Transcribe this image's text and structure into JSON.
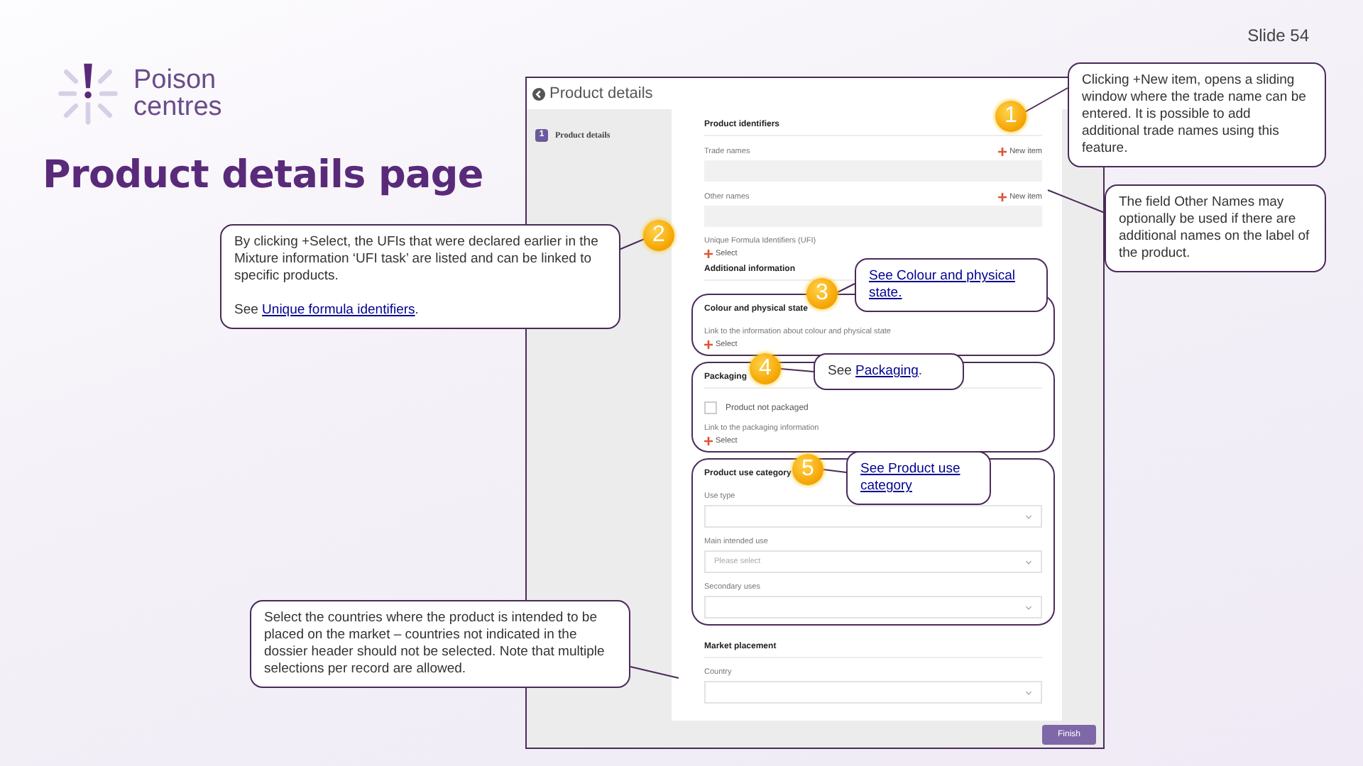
{
  "slide_number": "Slide 54",
  "logo": {
    "line_1": "Poison",
    "line_2": "centres"
  },
  "title": "Product details page",
  "app": {
    "title": "Product details",
    "steps": [
      {
        "number": "1",
        "label": "Product details",
        "selected": true
      }
    ],
    "sections": [
      {
        "outlined": false,
        "items": [
          {
            "kind": "heading",
            "text": "Product identifiers"
          },
          {
            "kind": "label",
            "text": "Trade names",
            "action": "New item"
          },
          {
            "kind": "input"
          },
          {
            "kind": "label",
            "text": "Other names",
            "action": "New item"
          },
          {
            "kind": "input"
          },
          {
            "kind": "label",
            "text": "Unique Formula Identifiers (UFI)"
          },
          {
            "kind": "add",
            "text": "Select"
          },
          {
            "kind": "heading",
            "text": "Additional information"
          }
        ]
      },
      {
        "outlined": true,
        "items": [
          {
            "kind": "subheading",
            "text": "Colour and physical state"
          },
          {
            "kind": "label",
            "text": "Link to the information about colour and physical state"
          },
          {
            "kind": "add",
            "text": "Select"
          }
        ]
      },
      {
        "outlined": true,
        "items": [
          {
            "kind": "heading",
            "text": "Packaging"
          },
          {
            "kind": "checkbox",
            "text": "Product not packaged",
            "checked": false
          },
          {
            "kind": "label",
            "text": "Link to the packaging information"
          },
          {
            "kind": "add",
            "text": "Select"
          }
        ]
      },
      {
        "outlined": true,
        "items": [
          {
            "kind": "subheading",
            "text": "Product use category"
          },
          {
            "kind": "label",
            "text": "Use type"
          },
          {
            "kind": "dropdown"
          },
          {
            "kind": "label",
            "text": "Main intended use"
          },
          {
            "kind": "dropdown",
            "placeholder": "Please select"
          },
          {
            "kind": "label",
            "text": "Secondary uses"
          },
          {
            "kind": "dropdown"
          }
        ]
      },
      {
        "outlined": false,
        "items": [
          {
            "kind": "heading",
            "text": "Market placement"
          },
          {
            "kind": "label",
            "text": "Country"
          },
          {
            "kind": "dropdown"
          }
        ]
      }
    ],
    "finish_button": "Finish"
  },
  "markers": [
    "1",
    "2",
    "3",
    "4",
    "5"
  ],
  "callouts": [
    {
      "text": "Clicking +New item, opens a sliding window where the trade name can be entered. It is possible to add additional trade names using this feature."
    },
    {
      "text": "The field Other Names may optionally be used if there are additional names on the label of the product."
    },
    {
      "text": "By clicking +Select, the UFIs that were declared earlier in the Mixture information ‘UFI task’ are listed and can be linked to specific products.",
      "link_before": "See ",
      "link": "Unique formula identifiers",
      "link_after": "."
    },
    {
      "link": "See Colour and physical state."
    },
    {
      "link_before": "See ",
      "link": "Packaging",
      "link_after": "."
    },
    {
      "link": "See Product use category"
    },
    {
      "text": "Select the countries where the product is intended to be placed on the market – countries not indicated in the dossier header should not be selected. Note that multiple selections per record are allowed."
    }
  ]
}
